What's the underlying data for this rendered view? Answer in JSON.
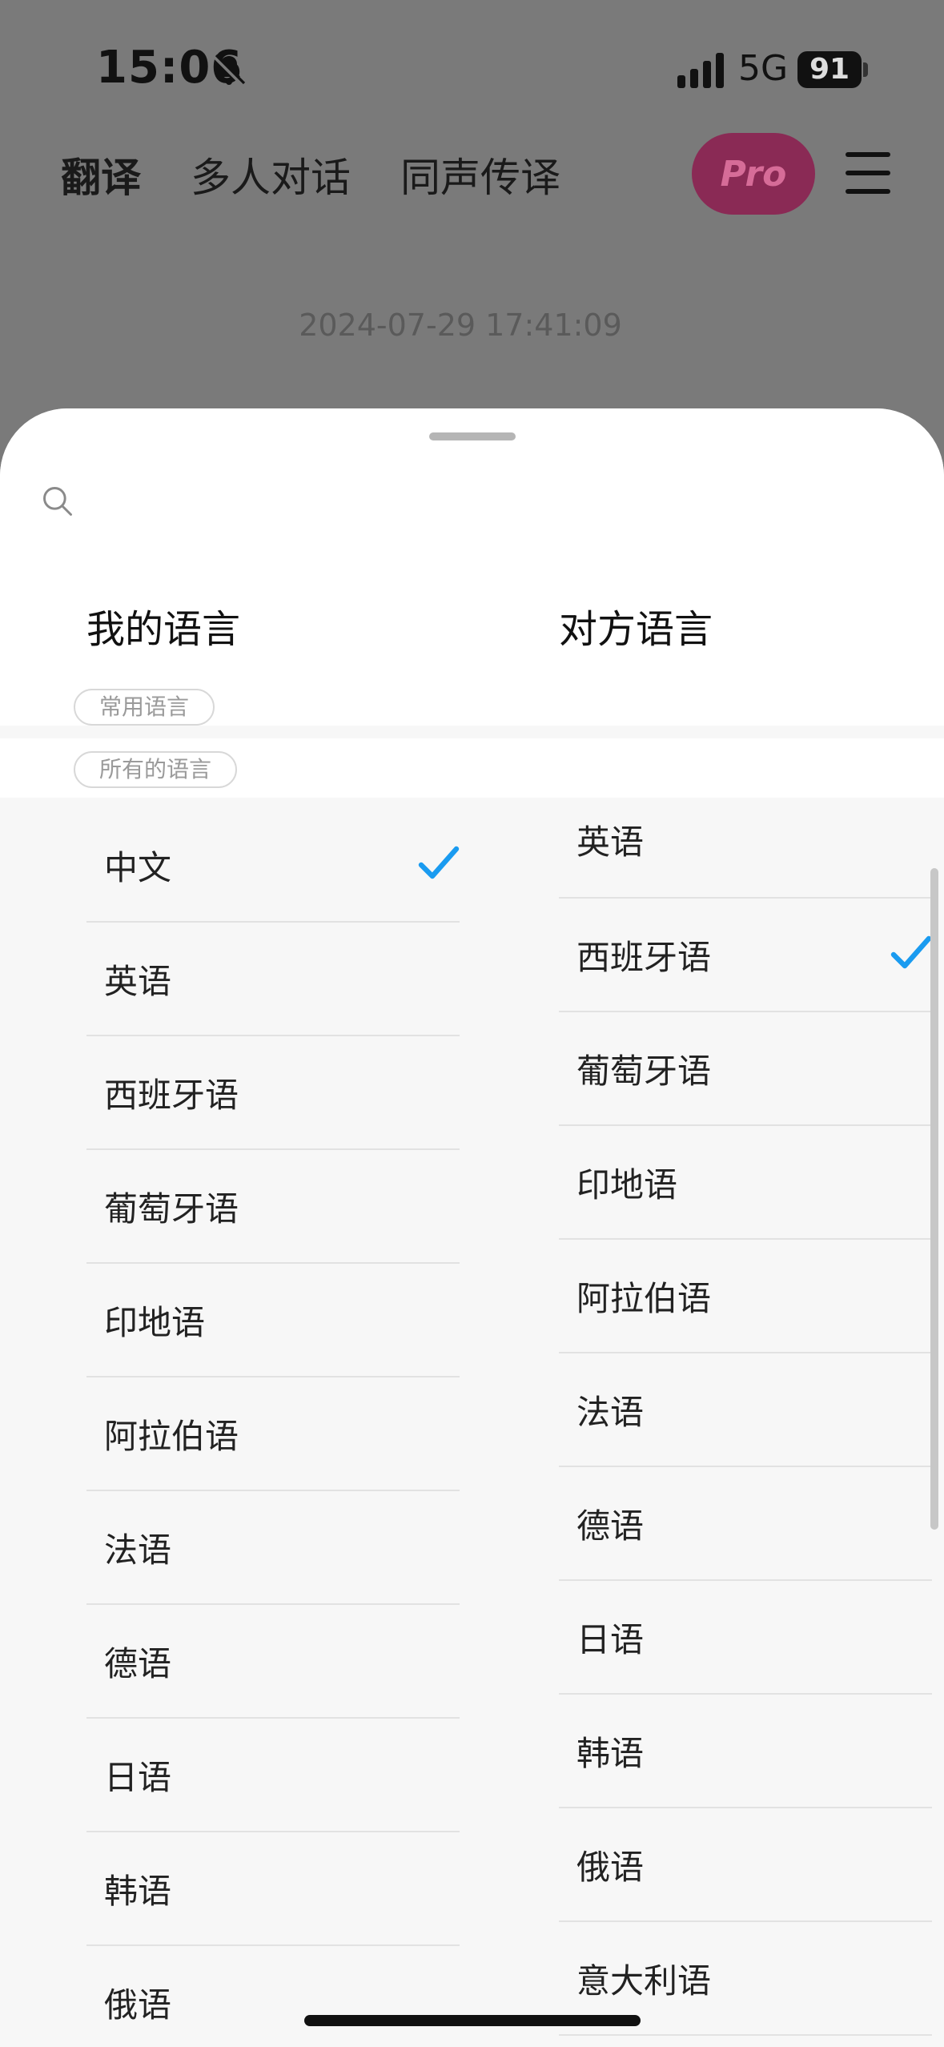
{
  "status_bar": {
    "time": "15:06",
    "network": "5G",
    "battery": "91"
  },
  "header": {
    "tabs": [
      {
        "label": "翻译",
        "active": true
      },
      {
        "label": "多人对话",
        "active": false
      },
      {
        "label": "同声传译",
        "active": false
      }
    ],
    "pro_label": "Pro"
  },
  "timestamp": "2024-07-29 17:41:09",
  "sheet": {
    "my_language_title": "我的语言",
    "other_language_title": "对方语言",
    "common_label": "常用语言",
    "all_label": "所有的语言",
    "my_languages": [
      "中文",
      "英语",
      "西班牙语",
      "葡萄牙语",
      "印地语",
      "阿拉伯语",
      "法语",
      "德语",
      "日语",
      "韩语",
      "俄语"
    ],
    "my_selected": "中文",
    "other_languages": [
      "英语",
      "西班牙语",
      "葡萄牙语",
      "印地语",
      "阿拉伯语",
      "法语",
      "德语",
      "日语",
      "韩语",
      "俄语",
      "意大利语"
    ],
    "other_selected": "西班牙语"
  },
  "colors": {
    "check": "#1a9bf0",
    "pro_bg": "#8a2a55",
    "overlay": "#7a7a7a"
  }
}
